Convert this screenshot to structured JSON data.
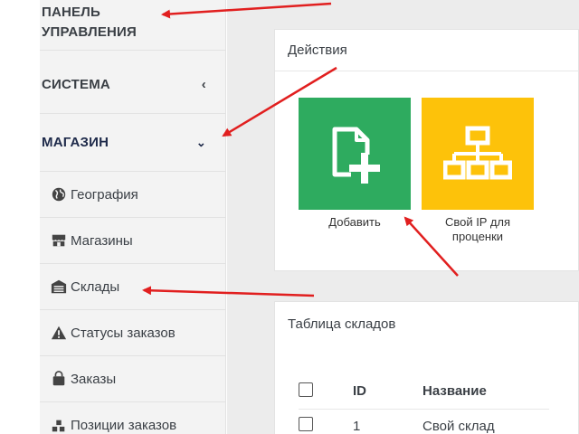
{
  "sidebar": {
    "panel_title_line1": "ПАНЕЛЬ",
    "panel_title_line2": "УПРАВЛЕНИЯ",
    "system_label": "СИСТЕМА",
    "shop_label": "МАГАЗИН",
    "items": [
      {
        "label": "География",
        "icon": "globe-icon"
      },
      {
        "label": "Магазины",
        "icon": "store-icon"
      },
      {
        "label": "Склады",
        "icon": "warehouse-icon"
      },
      {
        "label": "Статусы заказов",
        "icon": "warning-icon"
      },
      {
        "label": "Заказы",
        "icon": "bag-icon"
      },
      {
        "label": "Позиции заказов",
        "icon": "cubes-icon"
      }
    ]
  },
  "actions": {
    "title": "Действия",
    "add_label": "Добавить",
    "ip_label_line1": "Свой IP для",
    "ip_label_line2": "проценки",
    "add_color": "#2eab5f",
    "ip_color": "#fdc20a"
  },
  "warehouses": {
    "title": "Таблица складов",
    "columns": [
      "ID",
      "Название"
    ],
    "rows": [
      {
        "id": "1",
        "name": "Свой склад"
      }
    ]
  },
  "annotation_color": "#e11f1f"
}
